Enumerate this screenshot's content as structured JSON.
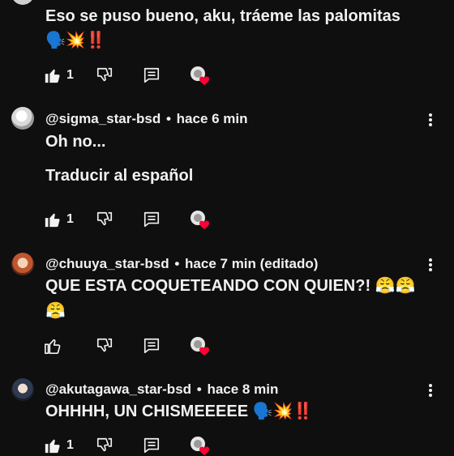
{
  "comments": [
    {
      "text_line1": "Eso se puso bueno, aku, tráeme las palomitas",
      "text_emoji": "🗣️💥‼️",
      "like_count": "1"
    },
    {
      "username": "@sigma_star-bsd",
      "time": "hace 6 min",
      "text": "Oh no...",
      "translate_label": "Traducir al español",
      "like_count": "1"
    },
    {
      "username": "@chuuya_star-bsd",
      "time": "hace 7 min (editado)",
      "text_line1": "QUE ESTA COQUETEANDO CON QUIEN?! 😤😤",
      "text_line2": "😤"
    },
    {
      "username": "@akutagawa_star-bsd",
      "time": "hace 8 min",
      "text": "OHHHH, UN CHISMEEEEE 🗣️💥‼️",
      "like_count": "1"
    }
  ],
  "separator": "•",
  "icons": {
    "like": "thumbs-up-icon",
    "dislike": "thumbs-down-icon",
    "reply": "reply-comment-icon",
    "creator_heart": "creator-heart-icon",
    "more": "more-vert-icon"
  }
}
